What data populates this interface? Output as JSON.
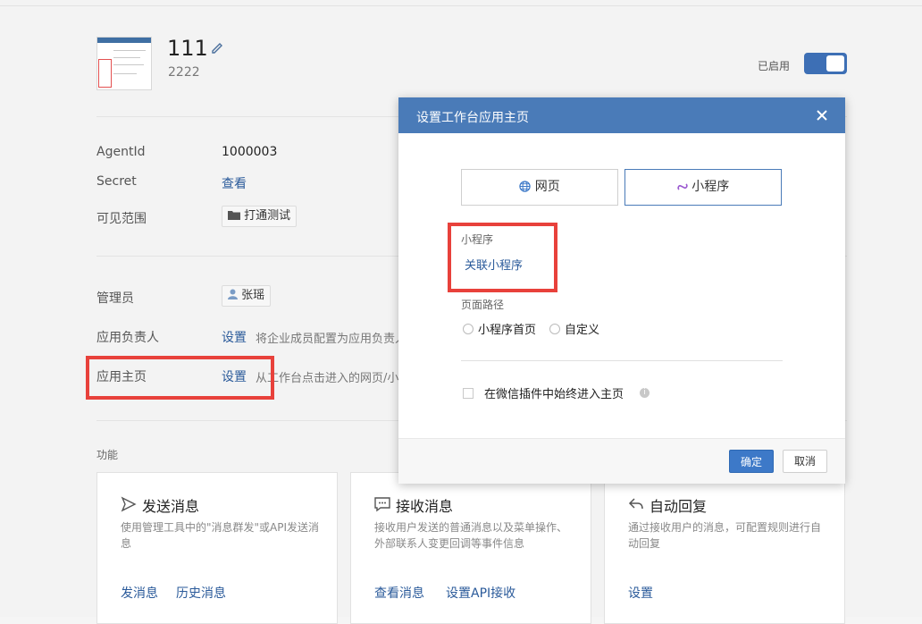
{
  "app": {
    "name": "111",
    "description": "2222",
    "enabled_label": "已启用",
    "enabled": true
  },
  "info": {
    "agentid_label": "AgentId",
    "agentid_value": "1000003",
    "secret_label": "Secret",
    "secret_link": "查看",
    "visibility_label": "可见范围",
    "visibility_tag": "打通测试"
  },
  "admin": {
    "manager_label": "管理员",
    "manager_tag": "张瑶",
    "owner_label": "应用负责人",
    "owner_link": "设置",
    "owner_hint": "将企业成员配置为应用负责人",
    "homepage_label": "应用主页",
    "homepage_link": "设置",
    "homepage_hint": "从工作台点击进入的网页/小"
  },
  "features": {
    "section_label": "功能",
    "cards": [
      {
        "title": "发送消息",
        "desc": "使用管理工具中的\"消息群发\"或API发送消息",
        "links": [
          "发消息",
          "历史消息"
        ],
        "icon": "send-icon"
      },
      {
        "title": "接收消息",
        "desc": "接收用户发送的普通消息以及菜单操作、外部联系人变更回调等事件信息",
        "links": [
          "查看消息",
          "设置API接收"
        ],
        "icon": "chat-icon"
      },
      {
        "title": "自动回复",
        "desc": "通过接收用户的消息，可配置规则进行自动回复",
        "links": [
          "设置"
        ],
        "icon": "reply-icon"
      }
    ]
  },
  "modal": {
    "title": "设置工作台应用主页",
    "tab_web": "网页",
    "tab_miniprogram": "小程序",
    "miniprogram_label": "小程序",
    "link_miniprogram": "关联小程序",
    "path_label": "页面路径",
    "radio_home": "小程序首页",
    "radio_custom": "自定义",
    "checkbox_label": "在微信插件中始终进入主页",
    "ok": "确定",
    "cancel": "取消"
  },
  "colors": {
    "accent": "#4a7bb8",
    "link": "#2a5a9a",
    "highlight": "#e8413b"
  }
}
